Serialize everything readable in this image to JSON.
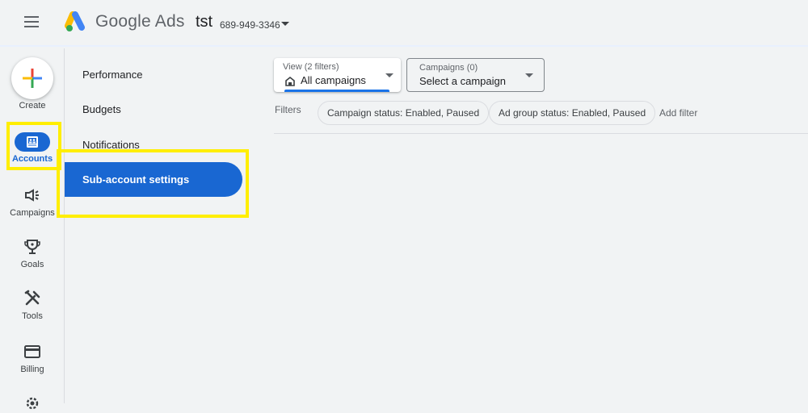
{
  "header": {
    "brand": "Google Ads",
    "account_name": "tst",
    "account_id": "689-949-3346"
  },
  "rail": {
    "create_label": "Create",
    "items": [
      {
        "label": "Accounts",
        "icon": "accounts-icon",
        "active": true
      },
      {
        "label": "Campaigns",
        "icon": "megaphone-icon"
      },
      {
        "label": "Goals",
        "icon": "trophy-icon"
      },
      {
        "label": "Tools",
        "icon": "tools-icon"
      },
      {
        "label": "Billing",
        "icon": "credit-card-icon"
      },
      {
        "label": "",
        "icon": "gear-icon"
      }
    ]
  },
  "subnav": {
    "items": [
      "Performance",
      "Budgets",
      "Notifications"
    ],
    "active": "Sub-account settings"
  },
  "toolbar": {
    "view": {
      "caption": "View (2 filters)",
      "value": "All campaigns"
    },
    "campaigns": {
      "caption": "Campaigns (0)",
      "value": "Select a campaign"
    }
  },
  "filters": {
    "label": "Filters",
    "chips": [
      "Campaign status: Enabled, Paused",
      "Ad group status: Enabled, Paused"
    ],
    "add_label": "Add filter"
  },
  "colors": {
    "accent": "#1967d2",
    "highlight": "#ffee00",
    "background": "#f1f3f4"
  }
}
